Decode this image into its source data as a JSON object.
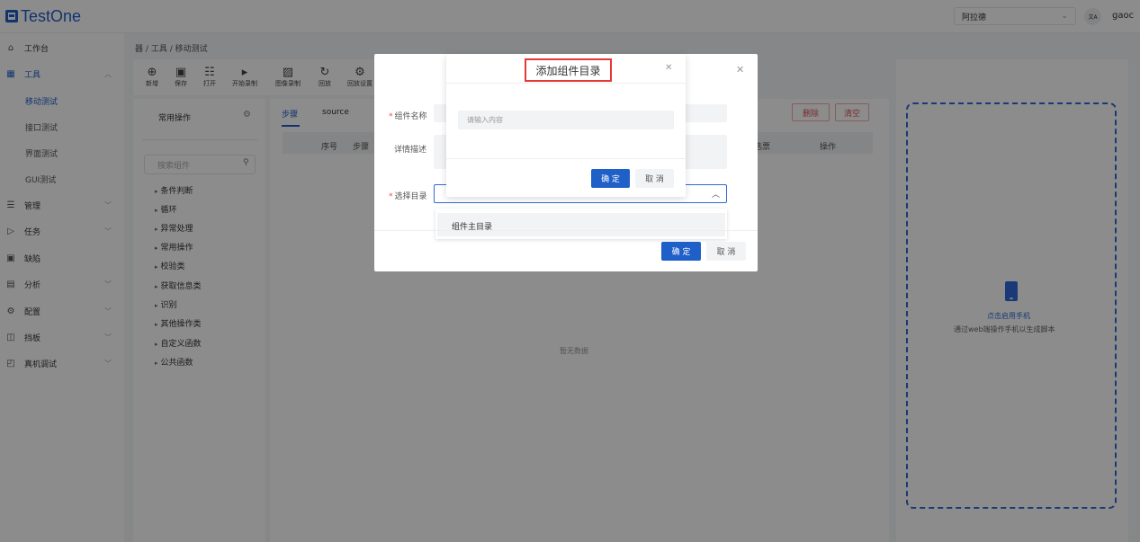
{
  "app": {
    "name": "TestOne"
  },
  "header": {
    "project": "阿拉德",
    "lang_icon": "文A",
    "user": "gaoc"
  },
  "sidebar": {
    "items": [
      {
        "label": "工作台",
        "icon": "home-icon"
      },
      {
        "label": "工具",
        "icon": "grid-icon"
      },
      {
        "label": "移动测试"
      },
      {
        "label": "接口测试"
      },
      {
        "label": "界面测试"
      },
      {
        "label": "GUI测试"
      },
      {
        "label": "管理",
        "icon": "list-icon"
      },
      {
        "label": "任务",
        "icon": "play-icon"
      },
      {
        "label": "缺陷",
        "icon": "bug-icon"
      },
      {
        "label": "分析",
        "icon": "chart-icon"
      },
      {
        "label": "配置",
        "icon": "gear-icon"
      },
      {
        "label": "挡板",
        "icon": "panel-icon"
      },
      {
        "label": "真机调试",
        "icon": "device-icon"
      }
    ]
  },
  "breadcrumb": {
    "root": "器",
    "sep": "/",
    "level1": "工具",
    "level2": "移动测试"
  },
  "toolbar": {
    "new": "新增",
    "save": "保存",
    "open": "打开",
    "start_record": "开始录制",
    "image_record": "图像录制",
    "replay": "回放",
    "replay_settings": "回放设置"
  },
  "left_panel": {
    "title": "常用操作",
    "search_placeholder": "搜索组件",
    "tree": [
      "条件判断",
      "循环",
      "异常处理",
      "常用操作",
      "校验类",
      "获取信息类",
      "识别",
      "其他操作类",
      "自定义函数",
      "公共函数"
    ]
  },
  "center": {
    "tabs": [
      "步骤",
      "source"
    ],
    "columns": [
      "序号",
      "步骤",
      "选票",
      "操作"
    ],
    "delete_label": "删除",
    "clear_label": "清空",
    "empty_text": "暂无数据"
  },
  "right_panel": {
    "start_phone": "点击启用手机",
    "hint": "通过web端操作手机以生成脚本"
  },
  "component_dialog": {
    "name_label": "组件名称",
    "desc_label": "详情描述",
    "dir_label": "选择目录",
    "option": "组件主目录",
    "confirm": "确 定",
    "cancel": "取 消"
  },
  "dir_dialog": {
    "title": "添加组件目录",
    "placeholder": "请输入内容",
    "confirm": "确 定",
    "cancel": "取 消"
  },
  "colors": {
    "primary": "#1f5fc8",
    "danger": "#e34d4d",
    "highlight": "#e53935"
  }
}
